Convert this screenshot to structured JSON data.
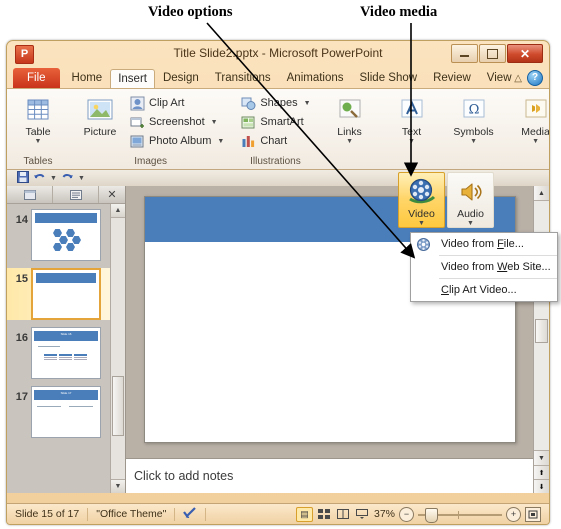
{
  "annotations": [
    {
      "id": "video-options",
      "text": "Video options"
    },
    {
      "id": "video-media",
      "text": "Video media"
    }
  ],
  "window": {
    "title": "Title Slide2.pptx  -  Microsoft PowerPoint",
    "app_badge": "P",
    "controls": {
      "minimize": "minimize-icon",
      "restore": "restore-icon",
      "close": "✕"
    }
  },
  "ribbon": {
    "tabs": [
      {
        "label": "File",
        "active": false,
        "file": true
      },
      {
        "label": "Home",
        "active": false,
        "file": false
      },
      {
        "label": "Insert",
        "active": true,
        "file": false
      },
      {
        "label": "Design",
        "active": false,
        "file": false
      },
      {
        "label": "Transitions",
        "active": false,
        "file": false
      },
      {
        "label": "Animations",
        "active": false,
        "file": false
      },
      {
        "label": "Slide Show",
        "active": false,
        "file": false
      },
      {
        "label": "Review",
        "active": false,
        "file": false
      },
      {
        "label": "View",
        "active": false,
        "file": false
      }
    ],
    "minimize_ribbon_icon": "chevron-up-icon",
    "help_icon": "?",
    "groups": [
      {
        "name": "Tables",
        "label": "Tables",
        "buttons": [
          {
            "label": "Table",
            "icon": "table-icon",
            "has_caret": true
          }
        ]
      },
      {
        "name": "Images",
        "label": "Images",
        "big": [
          {
            "label": "Picture",
            "icon": "picture-icon",
            "has_caret": false
          }
        ],
        "small": [
          {
            "label": "Clip Art",
            "icon": "clip-art-icon",
            "has_caret": false
          },
          {
            "label": "Screenshot",
            "icon": "screenshot-icon",
            "has_caret": true
          },
          {
            "label": "Photo Album",
            "icon": "photo-album-icon",
            "has_caret": true
          }
        ]
      },
      {
        "name": "Illustrations",
        "label": "Illustrations",
        "small": [
          {
            "label": "Shapes",
            "icon": "shapes-icon",
            "has_caret": true
          },
          {
            "label": "SmartArt",
            "icon": "smartart-icon",
            "has_caret": false
          },
          {
            "label": "Chart",
            "icon": "chart-icon",
            "has_caret": false
          }
        ]
      },
      {
        "name": "Links",
        "label": "",
        "buttons": [
          {
            "label": "Links",
            "icon": "links-icon",
            "has_caret": true
          }
        ]
      },
      {
        "name": "Text",
        "label": "",
        "buttons": [
          {
            "label": "Text",
            "icon": "text-icon",
            "has_caret": true
          }
        ]
      },
      {
        "name": "Symbols",
        "label": "",
        "buttons": [
          {
            "label": "Symbols",
            "icon": "omega-icon",
            "has_caret": true
          }
        ]
      },
      {
        "name": "Media",
        "label": "",
        "buttons": [
          {
            "label": "Media",
            "icon": "media-icon",
            "has_caret": true
          }
        ]
      }
    ]
  },
  "quick_access": {
    "save": "save-icon",
    "undo": "undo-icon",
    "redo": "redo-icon",
    "customize": "chevron-down-icon"
  },
  "media_flyout": {
    "video_label": "Video",
    "video_icon": "film-reel-icon",
    "audio_label": "Audio",
    "audio_icon": "speaker-icon",
    "highlight_color": "#ffd569"
  },
  "video_menu": {
    "items": [
      {
        "pre": "Video from ",
        "key": "F",
        "post": "ile...",
        "icon": "clip-art-video-icon"
      },
      {
        "pre": "Video from ",
        "key": "W",
        "post": "eb Site...",
        "icon": ""
      },
      {
        "pre": "",
        "key": "C",
        "post": "lip Art Video...",
        "icon": ""
      }
    ]
  },
  "slides_panel": {
    "tabs": [
      {
        "label": "",
        "icon": "slides-tab-icon"
      },
      {
        "label": "",
        "icon": "outline-tab-icon"
      },
      {
        "label": "",
        "icon": "close-icon"
      }
    ],
    "close_glyph": "✕",
    "thumbnails": [
      {
        "number": "14",
        "type": "smartart",
        "selected": false
      },
      {
        "number": "15",
        "type": "blank",
        "selected": true
      },
      {
        "number": "16",
        "type": "table",
        "selected": false,
        "title": "Slide 16",
        "bullet": "Sample Text"
      },
      {
        "number": "17",
        "type": "twocol",
        "selected": false,
        "title": "Slide 17",
        "left": "Sample Text",
        "right": "Sample Text"
      }
    ]
  },
  "slide": {
    "title_band_color": "#4a7ebb",
    "background": "#ffffff"
  },
  "notes": {
    "placeholder": "Click to add notes"
  },
  "scrollbars": {
    "up_glyph": "▲",
    "down_glyph": "▼",
    "prev_slide_glyph": "⬆",
    "next_slide_glyph": "⬇"
  },
  "status_bar": {
    "slide_count": "Slide 15 of 17",
    "theme": "\"Office Theme\"",
    "spellcheck_icon": "spellcheck-icon",
    "views": [
      {
        "name": "normal",
        "glyph": "▤",
        "active": true
      },
      {
        "name": "slide-sorter",
        "glyph": "∷",
        "active": false
      },
      {
        "name": "reading-view",
        "glyph": "▥",
        "active": false
      },
      {
        "name": "slide-show",
        "glyph": "▽",
        "active": false
      }
    ],
    "zoom_level": "37%",
    "zoom_out_glyph": "−",
    "zoom_in_glyph": "+",
    "fit_glyph": "⬚"
  }
}
